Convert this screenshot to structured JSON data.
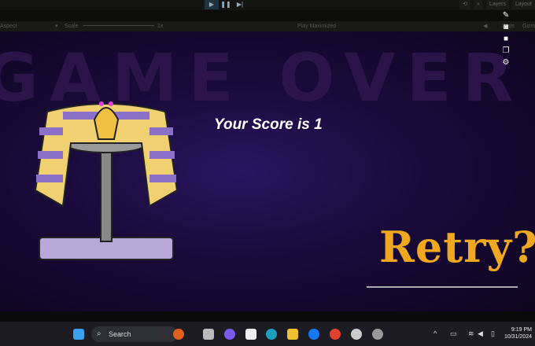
{
  "editor": {
    "layers_label": "Layers",
    "layout_label": "Layout",
    "aspect_label": "Aspect",
    "scale_label": "Scale",
    "scale_value": "1x",
    "play_mode": "Play Maximized",
    "stats_label": "Stats",
    "gizmos_label": "Gizmos"
  },
  "game": {
    "background_title": "GAME OVER",
    "score_text": "Your Score is  1",
    "retry_label": "Retry?",
    "colors": {
      "retry": "#f0a820",
      "background": "#1a0a3a"
    }
  },
  "taskbar": {
    "search_placeholder": "Search",
    "time": "9:19 PM",
    "date": "10/31/2024"
  }
}
